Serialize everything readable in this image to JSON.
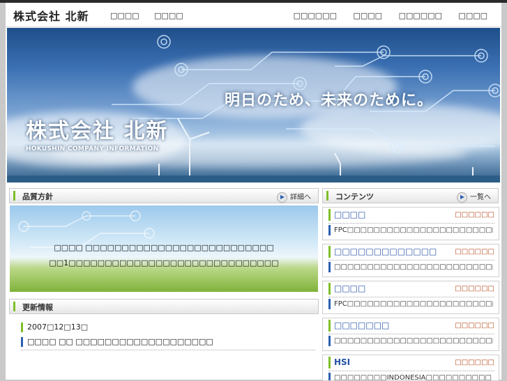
{
  "header": {
    "logo": "株式会社 北新",
    "nav_left": [
      "□□□□",
      "□□□□"
    ],
    "nav_right": [
      "□□□□□□",
      "□□□□",
      "□□□□□□",
      "□□□□"
    ]
  },
  "hero": {
    "tagline": "明日のため、未来のために。",
    "company_jp": "株式会社 北新",
    "company_en": "HOKUSHIN COMPANY INFORMATION"
  },
  "quality": {
    "title": "品質方針",
    "more": "詳細へ",
    "line1": "□□□□ □□□□□□□□□□□□□□□□□□□□□□□□□□",
    "line2": "□□1□□□□□□□□□□□□□□□□□□□□□□□□□□□□□"
  },
  "news": {
    "title": "更新情報",
    "date": "2007□12□13□",
    "item": "□□□□ □□ □□□□□□□□□□□□□□□□□□□"
  },
  "contents": {
    "title": "コンテンツ",
    "more": "一覧へ",
    "items": [
      {
        "title": "□□□□",
        "tag": "□□□□□□",
        "desc": "FPC□□□□□□□□□□□□□□□□□□□□□□□□□□□□□□□□□□"
      },
      {
        "title": "□□□□□□□□□□□□□",
        "tag": "□□□□□□",
        "desc": "□□□□□□□□□□□□□□□□□□□□□□□□□□□□□□□□□□□□□"
      },
      {
        "title": "□□□□",
        "tag": "□□□□□□",
        "desc": "FPC□□□□□□□□□□□□□□□□□□□□□□□□□"
      },
      {
        "title": "□□□□□□□",
        "tag": "□□□□□□",
        "desc": "□□□□□□□□□□□□□□□□□□□□□□□□□□"
      },
      {
        "title": "HSI",
        "tag": "□□□□□□",
        "desc": "□□□□□□□□INDONESIA□□□□□□□□□□"
      }
    ]
  },
  "colors": {
    "accent_green": "#7fbf2a",
    "accent_blue": "#2a5fb0",
    "tag_red": "#b3471a"
  }
}
